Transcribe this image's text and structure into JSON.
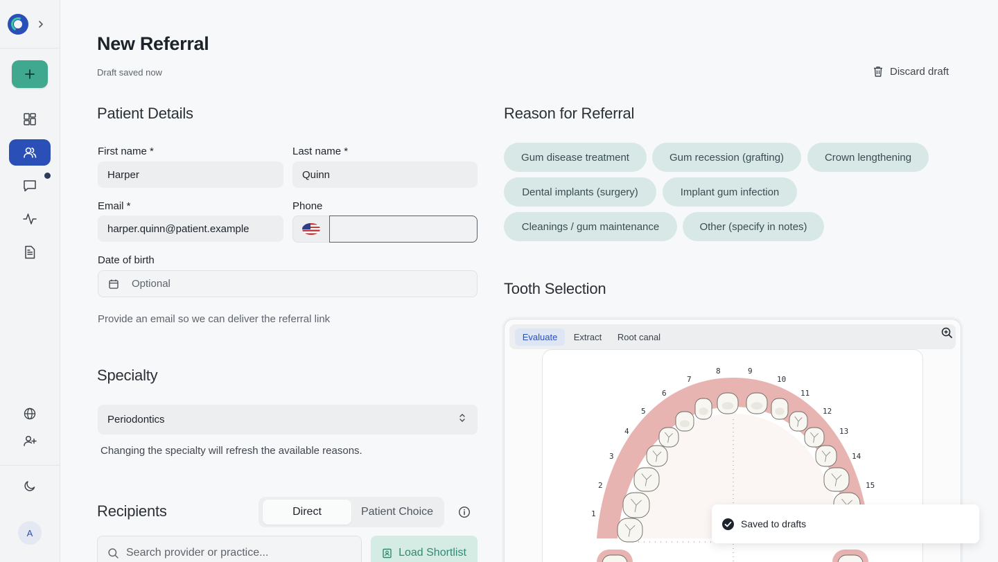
{
  "sidebar": {
    "avatar_initial": "A"
  },
  "header": {
    "title": "New Referral",
    "draft_status": "Draft saved now",
    "discard_label": "Discard draft"
  },
  "patient": {
    "section_title": "Patient Details",
    "first_name_label": "First name *",
    "first_name_value": "Harper",
    "last_name_label": "Last name *",
    "last_name_value": "Quinn",
    "email_label": "Email *",
    "email_value": "harper.quinn@patient.example",
    "phone_label": "Phone",
    "phone_value": "",
    "dob_label": "Date of birth",
    "dob_placeholder": "Optional",
    "email_hint": "Provide an email so we can deliver the referral link"
  },
  "specialty": {
    "section_title": "Specialty",
    "selected": "Periodontics",
    "hint": "Changing the specialty will refresh the available reasons."
  },
  "recipients": {
    "section_title": "Recipients",
    "modes": [
      "Direct",
      "Patient Choice"
    ],
    "active_mode": "Direct",
    "search_placeholder": "Search provider or practice...",
    "load_shortlist_label": "Load Shortlist"
  },
  "reasons": {
    "section_title": "Reason for Referral",
    "chips": [
      "Gum disease treatment",
      "Gum recession (grafting)",
      "Crown lengthening",
      "Dental implants (surgery)",
      "Implant gum infection",
      "Cleanings / gum maintenance",
      "Other (specify in notes)"
    ]
  },
  "tooth_selection": {
    "section_title": "Tooth Selection",
    "tabs": [
      "Evaluate",
      "Extract",
      "Root canal"
    ],
    "active_tab": "Evaluate",
    "tooth_numbers": [
      "1",
      "2",
      "3",
      "4",
      "5",
      "6",
      "7",
      "8",
      "9",
      "10",
      "11",
      "12",
      "13",
      "14",
      "15"
    ]
  },
  "toast": {
    "message": "Saved to drafts"
  },
  "colors": {
    "primary": "#2a4fb7",
    "accent_green": "#3fa88f",
    "chip_bg": "#d7e8e6",
    "gum": "#e8b4b2"
  }
}
